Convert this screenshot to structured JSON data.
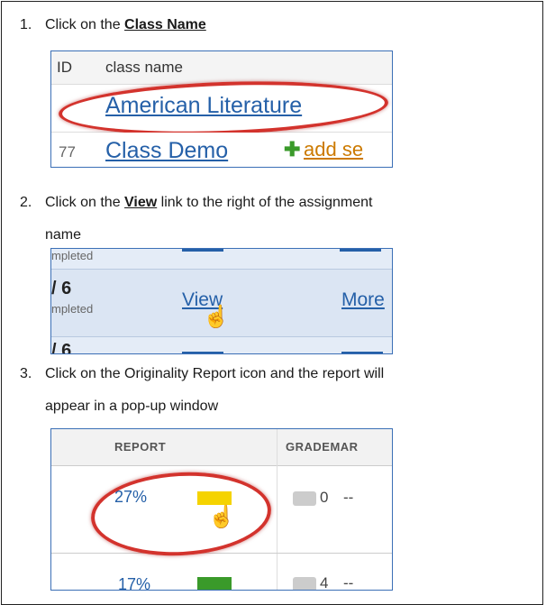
{
  "steps": [
    {
      "num": "1.",
      "pre": "Click on the ",
      "bold": "Class Name",
      "post": ""
    },
    {
      "num": "2.",
      "pre": "Click on the ",
      "bold": "View",
      "post": " link to the right of the assignment",
      "line2": "name"
    },
    {
      "num": "3.",
      "text": "Click on the Originality Report icon and the report will",
      "line2": "appear in a pop-up window"
    }
  ],
  "shot1": {
    "header_id": "ID",
    "header_name": "class name",
    "row1_link": "American Literature",
    "row2_id": "77",
    "row2_link": "Class Demo",
    "row2_add": "add se",
    "plus_icon": "plus-icon"
  },
  "shot2": {
    "top_sub": "mpleted",
    "mid_count": "/ 6",
    "mid_sub": "mpleted",
    "view_link": "View",
    "more_link": "More",
    "bot_count": "/ 6",
    "cursor_icon": "hand-pointer-icon"
  },
  "shot3": {
    "col_report": "REPORT",
    "col_grademark": "GRADEMAR",
    "row1_pct": "27%",
    "row1_bar_color": "#f5d300",
    "row1_count": "0",
    "row1_dash": "--",
    "row2_pct": "17%",
    "row2_bar_color": "#3a9a2a",
    "row2_count": "4",
    "row2_dash": "--"
  }
}
